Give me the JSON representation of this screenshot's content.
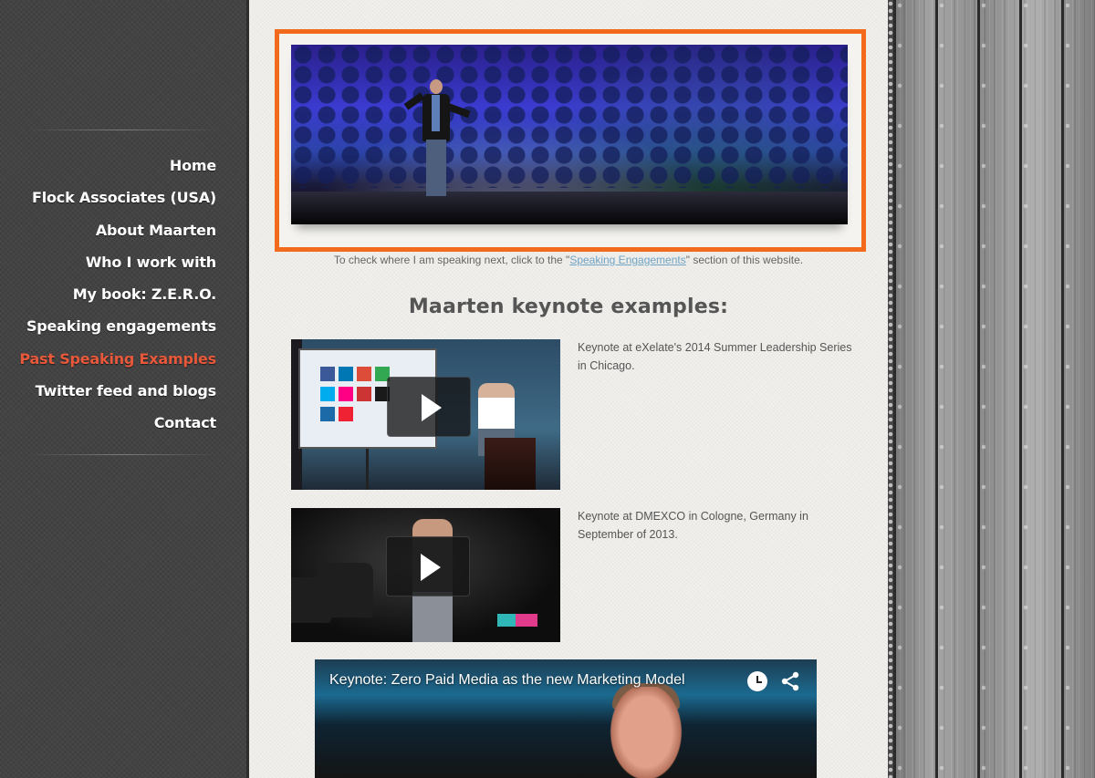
{
  "nav": {
    "items": [
      {
        "label": "Home",
        "active": false
      },
      {
        "label": "Flock Associates (USA)",
        "active": false
      },
      {
        "label": "About Maarten",
        "active": false
      },
      {
        "label": "Who I work with",
        "active": false
      },
      {
        "label": "My book: Z.E.R.O.",
        "active": false
      },
      {
        "label": "Speaking engagements",
        "active": false
      },
      {
        "label": "Past Speaking Examples",
        "active": true
      },
      {
        "label": "Twitter feed and blogs",
        "active": false
      },
      {
        "label": "Contact",
        "active": false
      }
    ]
  },
  "hero": {
    "caption_before": "To check where I am speaking next, click to the \"",
    "caption_link": "Speaking Engagements",
    "caption_after": "\" section of this website."
  },
  "main": {
    "section_title": "Maarten keynote examples:",
    "videos": [
      {
        "description": "Keynote at eXelate's 2014 Summer Leadership Series in Chicago."
      },
      {
        "description": "Keynote at DMEXCO in Cologne, Germany in September of 2013."
      }
    ],
    "youtube": {
      "title": "Keynote: Zero Paid Media as the new Marketing Model"
    }
  },
  "colors": {
    "accent_orange": "#f26a1b",
    "active_nav": "#e8583a",
    "link_blue": "#6fa3c6",
    "sidebar_bg": "#434343",
    "content_bg": "#f1f0ec"
  },
  "icons": [
    "play-icon",
    "clock-icon",
    "share-icon"
  ]
}
